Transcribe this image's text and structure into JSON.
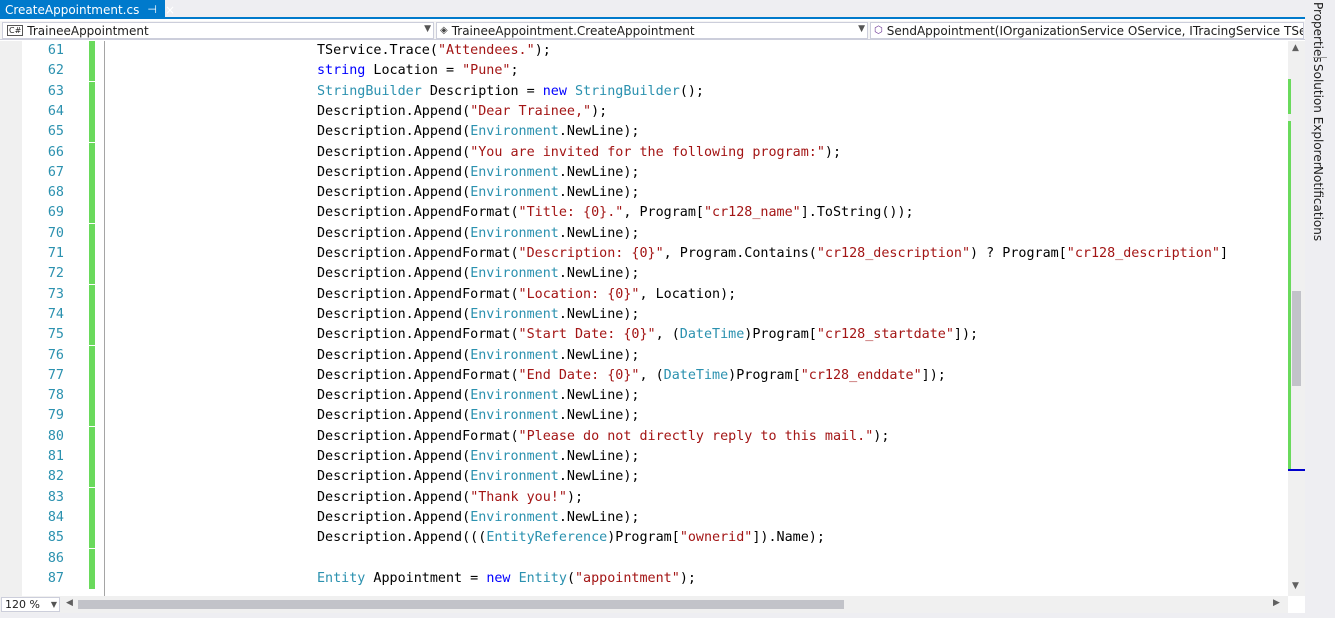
{
  "tab": {
    "title": "CreateAppointment.cs",
    "pin": "⊣",
    "close": "×"
  },
  "nav": {
    "project": "TraineeAppointment",
    "project_badge": "C#",
    "type": "TraineeAppointment.CreateAppointment",
    "member": "SendAppointment(IOrganizationService OService, ITracingService TService, E"
  },
  "side_panels": [
    "Properties",
    "Solution Explorer",
    "Notifications"
  ],
  "zoom": "120 %",
  "code_lines": [
    {
      "n": "61",
      "parts": [
        [
          "p",
          "TService.Trace("
        ],
        [
          "s",
          "\"Attendees.\""
        ],
        [
          "p",
          ");"
        ]
      ]
    },
    {
      "n": "62",
      "parts": [
        [
          "k",
          "string"
        ],
        [
          "p",
          " Location = "
        ],
        [
          "s",
          "\"Pune\""
        ],
        [
          "p",
          ";"
        ]
      ]
    },
    {
      "n": "63",
      "parts": [
        [
          "t",
          "StringBuilder"
        ],
        [
          "p",
          " Description = "
        ],
        [
          "k",
          "new"
        ],
        [
          "p",
          " "
        ],
        [
          "t",
          "StringBuilder"
        ],
        [
          "p",
          "();"
        ]
      ]
    },
    {
      "n": "64",
      "parts": [
        [
          "p",
          "Description.Append("
        ],
        [
          "s",
          "\"Dear Trainee,\""
        ],
        [
          "p",
          ");"
        ]
      ]
    },
    {
      "n": "65",
      "parts": [
        [
          "p",
          "Description.Append("
        ],
        [
          "t",
          "Environment"
        ],
        [
          "p",
          ".NewLine);"
        ]
      ]
    },
    {
      "n": "66",
      "parts": [
        [
          "p",
          "Description.Append("
        ],
        [
          "s",
          "\"You are invited for the following program:\""
        ],
        [
          "p",
          ");"
        ]
      ]
    },
    {
      "n": "67",
      "parts": [
        [
          "p",
          "Description.Append("
        ],
        [
          "t",
          "Environment"
        ],
        [
          "p",
          ".NewLine);"
        ]
      ]
    },
    {
      "n": "68",
      "parts": [
        [
          "p",
          "Description.Append("
        ],
        [
          "t",
          "Environment"
        ],
        [
          "p",
          ".NewLine);"
        ]
      ]
    },
    {
      "n": "69",
      "parts": [
        [
          "p",
          "Description.AppendFormat("
        ],
        [
          "s",
          "\"Title: {0}.\""
        ],
        [
          "p",
          ", Program["
        ],
        [
          "s",
          "\"cr128_name\""
        ],
        [
          "p",
          "].ToString());"
        ]
      ]
    },
    {
      "n": "70",
      "parts": [
        [
          "p",
          "Description.Append("
        ],
        [
          "t",
          "Environment"
        ],
        [
          "p",
          ".NewLine);"
        ]
      ]
    },
    {
      "n": "71",
      "parts": [
        [
          "p",
          "Description.AppendFormat("
        ],
        [
          "s",
          "\"Description: {0}\""
        ],
        [
          "p",
          ", Program.Contains("
        ],
        [
          "s",
          "\"cr128_description\""
        ],
        [
          "p",
          ") ? Program["
        ],
        [
          "s",
          "\"cr128_description\""
        ],
        [
          "p",
          "]"
        ]
      ]
    },
    {
      "n": "72",
      "parts": [
        [
          "p",
          "Description.Append("
        ],
        [
          "t",
          "Environment"
        ],
        [
          "p",
          ".NewLine);"
        ]
      ]
    },
    {
      "n": "73",
      "parts": [
        [
          "p",
          "Description.AppendFormat("
        ],
        [
          "s",
          "\"Location: {0}\""
        ],
        [
          "p",
          ", Location);"
        ]
      ]
    },
    {
      "n": "74",
      "parts": [
        [
          "p",
          "Description.Append("
        ],
        [
          "t",
          "Environment"
        ],
        [
          "p",
          ".NewLine);"
        ]
      ]
    },
    {
      "n": "75",
      "parts": [
        [
          "p",
          "Description.AppendFormat("
        ],
        [
          "s",
          "\"Start Date: {0}\""
        ],
        [
          "p",
          ", ("
        ],
        [
          "t",
          "DateTime"
        ],
        [
          "p",
          ")Program["
        ],
        [
          "s",
          "\"cr128_startdate\""
        ],
        [
          "p",
          "]);"
        ]
      ]
    },
    {
      "n": "76",
      "parts": [
        [
          "p",
          "Description.Append("
        ],
        [
          "t",
          "Environment"
        ],
        [
          "p",
          ".NewLine);"
        ]
      ]
    },
    {
      "n": "77",
      "parts": [
        [
          "p",
          "Description.AppendFormat("
        ],
        [
          "s",
          "\"End Date: {0}\""
        ],
        [
          "p",
          ", ("
        ],
        [
          "t",
          "DateTime"
        ],
        [
          "p",
          ")Program["
        ],
        [
          "s",
          "\"cr128_enddate\""
        ],
        [
          "p",
          "]);"
        ]
      ]
    },
    {
      "n": "78",
      "parts": [
        [
          "p",
          "Description.Append("
        ],
        [
          "t",
          "Environment"
        ],
        [
          "p",
          ".NewLine);"
        ]
      ]
    },
    {
      "n": "79",
      "parts": [
        [
          "p",
          "Description.Append("
        ],
        [
          "t",
          "Environment"
        ],
        [
          "p",
          ".NewLine);"
        ]
      ]
    },
    {
      "n": "80",
      "parts": [
        [
          "p",
          "Description.AppendFormat("
        ],
        [
          "s",
          "\"Please do not directly reply to this mail.\""
        ],
        [
          "p",
          ");"
        ]
      ]
    },
    {
      "n": "81",
      "parts": [
        [
          "p",
          "Description.Append("
        ],
        [
          "t",
          "Environment"
        ],
        [
          "p",
          ".NewLine);"
        ]
      ]
    },
    {
      "n": "82",
      "parts": [
        [
          "p",
          "Description.Append("
        ],
        [
          "t",
          "Environment"
        ],
        [
          "p",
          ".NewLine);"
        ]
      ]
    },
    {
      "n": "83",
      "parts": [
        [
          "p",
          "Description.Append("
        ],
        [
          "s",
          "\"Thank you!\""
        ],
        [
          "p",
          ");"
        ]
      ]
    },
    {
      "n": "84",
      "parts": [
        [
          "p",
          "Description.Append("
        ],
        [
          "t",
          "Environment"
        ],
        [
          "p",
          ".NewLine);"
        ]
      ]
    },
    {
      "n": "85",
      "parts": [
        [
          "p",
          "Description.Append((("
        ],
        [
          "t",
          "EntityReference"
        ],
        [
          "p",
          ")Program["
        ],
        [
          "s",
          "\"ownerid\""
        ],
        [
          "p",
          "]).Name);"
        ]
      ]
    },
    {
      "n": "86",
      "parts": []
    },
    {
      "n": "87",
      "parts": [
        [
          "t",
          "Entity"
        ],
        [
          "p",
          " Appointment = "
        ],
        [
          "k",
          "new"
        ],
        [
          "p",
          " "
        ],
        [
          "t",
          "Entity"
        ],
        [
          "p",
          "("
        ],
        [
          "s",
          "\"appointment\""
        ],
        [
          "p",
          ");"
        ]
      ]
    }
  ]
}
